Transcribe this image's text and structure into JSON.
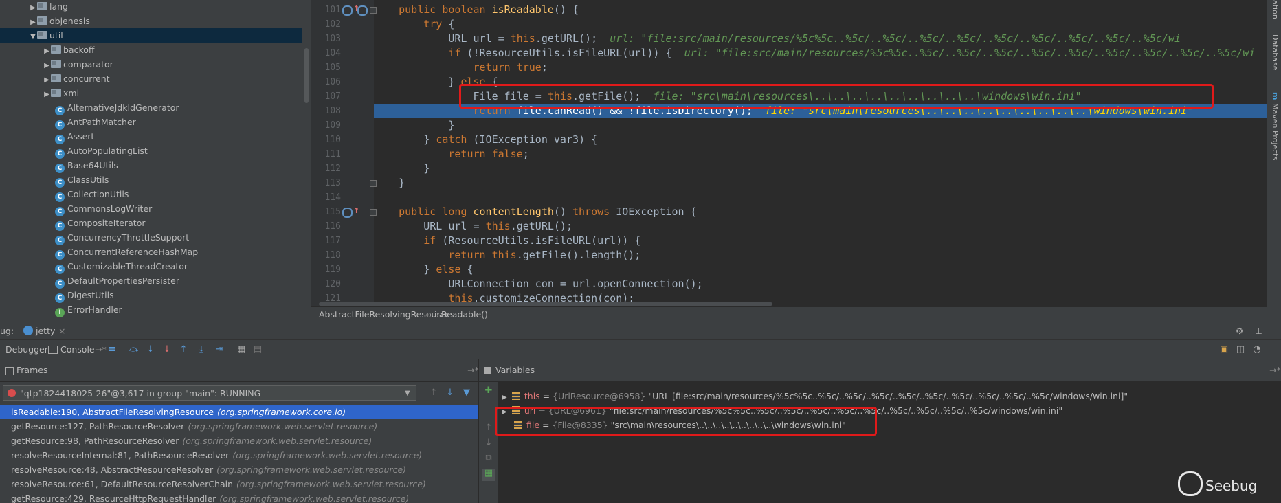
{
  "project_tree": [
    {
      "label": "lang",
      "kind": "folder",
      "depth": 2,
      "expanded": false,
      "selected": false
    },
    {
      "label": "objenesis",
      "kind": "folder",
      "depth": 2,
      "expanded": false,
      "selected": false
    },
    {
      "label": "util",
      "kind": "folder",
      "depth": 2,
      "expanded": true,
      "selected": true
    },
    {
      "label": "backoff",
      "kind": "folder",
      "depth": 3,
      "expanded": false,
      "selected": false
    },
    {
      "label": "comparator",
      "kind": "folder",
      "depth": 3,
      "expanded": false,
      "selected": false
    },
    {
      "label": "concurrent",
      "kind": "folder",
      "depth": 3,
      "expanded": false,
      "selected": false
    },
    {
      "label": "xml",
      "kind": "folder",
      "depth": 3,
      "expanded": false,
      "selected": false
    },
    {
      "label": "AlternativeJdkIdGenerator",
      "kind": "class",
      "depth": 3
    },
    {
      "label": "AntPathMatcher",
      "kind": "class",
      "depth": 3
    },
    {
      "label": "Assert",
      "kind": "class",
      "depth": 3
    },
    {
      "label": "AutoPopulatingList",
      "kind": "class",
      "depth": 3
    },
    {
      "label": "Base64Utils",
      "kind": "class",
      "depth": 3
    },
    {
      "label": "ClassUtils",
      "kind": "class",
      "depth": 3
    },
    {
      "label": "CollectionUtils",
      "kind": "class",
      "depth": 3
    },
    {
      "label": "CommonsLogWriter",
      "kind": "class",
      "depth": 3
    },
    {
      "label": "CompositeIterator",
      "kind": "class",
      "depth": 3
    },
    {
      "label": "ConcurrencyThrottleSupport",
      "kind": "class",
      "depth": 3
    },
    {
      "label": "ConcurrentReferenceHashMap",
      "kind": "class",
      "depth": 3
    },
    {
      "label": "CustomizableThreadCreator",
      "kind": "class",
      "depth": 3
    },
    {
      "label": "DefaultPropertiesPersister",
      "kind": "class",
      "depth": 3
    },
    {
      "label": "DigestUtils",
      "kind": "class",
      "depth": 3
    },
    {
      "label": "ErrorHandler",
      "kind": "interface",
      "depth": 3
    }
  ],
  "editor": {
    "lines": [
      {
        "n": "101",
        "segs": [
          [
            "kw",
            "    public boolean "
          ],
          [
            "fn",
            "isReadable"
          ],
          [
            "",
            "() {"
          ]
        ]
      },
      {
        "n": "102",
        "segs": [
          [
            "kw",
            "        try "
          ],
          [
            "",
            "{"
          ]
        ]
      },
      {
        "n": "103",
        "segs": [
          [
            "",
            "            URL url = "
          ],
          [
            "kw",
            "this"
          ],
          [
            "",
            ".getURL();  "
          ],
          [
            "hint",
            "url: \"file:src/main/resources/%5c%5c..%5c/..%5c/..%5c/..%5c/..%5c/..%5c/..%5c/..%5c/..%5c/wi"
          ]
        ]
      },
      {
        "n": "104",
        "segs": [
          [
            "kw",
            "            if "
          ],
          [
            "",
            "(!ResourceUtils."
          ],
          [
            "",
            "isFileURL(url)) {  "
          ],
          [
            "hint",
            "url: \"file:src/main/resources/%5c%5c..%5c/..%5c/..%5c/..%5c/..%5c/..%5c/..%5c/..%5c/..%5c/wi"
          ]
        ]
      },
      {
        "n": "105",
        "segs": [
          [
            "kw",
            "                return true"
          ],
          [
            "",
            ";"
          ]
        ]
      },
      {
        "n": "106",
        "segs": [
          [
            "",
            "            } "
          ],
          [
            "kw",
            "else "
          ],
          [
            "",
            "{"
          ]
        ]
      },
      {
        "n": "107",
        "segs": [
          [
            "",
            "                File file = "
          ],
          [
            "kw",
            "this"
          ],
          [
            "",
            ".getFile();  "
          ],
          [
            "hint",
            "file: \"src\\main\\resources\\..\\..\\..\\..\\..\\..\\..\\..\\..\\windows\\win.ini\""
          ]
        ]
      },
      {
        "n": "108",
        "exec": true,
        "segs": [
          [
            "kw",
            "                return "
          ],
          [
            "",
            "file.canRead() && !file.isDirectory();  "
          ],
          [
            "hint",
            "file: \"src\\main\\resources\\..\\..\\..\\..\\..\\..\\..\\..\\..\\windows\\win.ini\""
          ]
        ]
      },
      {
        "n": "109",
        "segs": [
          [
            "",
            "            }"
          ]
        ]
      },
      {
        "n": "110",
        "segs": [
          [
            "",
            "        } "
          ],
          [
            "kw",
            "catch "
          ],
          [
            "",
            "(IOException var3) {"
          ]
        ]
      },
      {
        "n": "111",
        "segs": [
          [
            "kw",
            "            return false"
          ],
          [
            "",
            ";"
          ]
        ]
      },
      {
        "n": "112",
        "segs": [
          [
            "",
            "        }"
          ]
        ]
      },
      {
        "n": "113",
        "segs": [
          [
            "",
            "    }"
          ]
        ]
      },
      {
        "n": "114",
        "segs": [
          [
            "",
            ""
          ]
        ]
      },
      {
        "n": "115",
        "segs": [
          [
            "kw",
            "    public long "
          ],
          [
            "fn",
            "contentLength"
          ],
          [
            "",
            "() "
          ],
          [
            "kw",
            "throws "
          ],
          [
            "",
            "IOException {"
          ]
        ]
      },
      {
        "n": "116",
        "segs": [
          [
            "",
            "        URL url = "
          ],
          [
            "kw",
            "this"
          ],
          [
            "",
            ".getURL();"
          ]
        ]
      },
      {
        "n": "117",
        "segs": [
          [
            "kw",
            "        if "
          ],
          [
            "",
            "(ResourceUtils."
          ],
          [
            "",
            "isFileURL(url)) {"
          ]
        ]
      },
      {
        "n": "118",
        "segs": [
          [
            "kw",
            "            return this"
          ],
          [
            "",
            ".getFile().length();"
          ]
        ]
      },
      {
        "n": "119",
        "segs": [
          [
            "",
            "        } "
          ],
          [
            "kw",
            "else "
          ],
          [
            "",
            "{"
          ]
        ]
      },
      {
        "n": "120",
        "segs": [
          [
            "",
            "            URLConnection con = url.openConnection();"
          ]
        ]
      },
      {
        "n": "121",
        "segs": [
          [
            "kw",
            "            this"
          ],
          [
            "",
            ".customizeConnection(con);"
          ]
        ]
      }
    ]
  },
  "breadcrumb": {
    "class": "AbstractFileResolvingResource",
    "sep": "›",
    "method": "isReadable()"
  },
  "right_strip": {
    "database": "Database",
    "maven": "Maven Projects",
    "top": "ation"
  },
  "debug": {
    "label": "ug:",
    "session_tab": "jetty",
    "tabs": {
      "debugger": "Debugger",
      "console": "Console",
      "console_suffix": "→*"
    },
    "frames_title": "Frames",
    "frames_pin": "→*",
    "variables_title": "Variables",
    "variables_pin": "→*",
    "thread": "\"qtp1824418025-26\"@3,617 in group \"main\": RUNNING",
    "frames": [
      {
        "method": "isReadable:190, AbstractFileResolvingResource",
        "pkg": "(org.springframework.core.io)",
        "selected": true
      },
      {
        "method": "getResource:127, PathResourceResolver",
        "pkg": "(org.springframework.web.servlet.resource)",
        "selected": false
      },
      {
        "method": "getResource:98, PathResourceResolver",
        "pkg": "(org.springframework.web.servlet.resource)",
        "selected": false
      },
      {
        "method": "resolveResourceInternal:81, PathResourceResolver",
        "pkg": "(org.springframework.web.servlet.resource)",
        "selected": false
      },
      {
        "method": "resolveResource:48, AbstractResourceResolver",
        "pkg": "(org.springframework.web.servlet.resource)",
        "selected": false
      },
      {
        "method": "resolveResource:61, DefaultResourceResolverChain",
        "pkg": "(org.springframework.web.servlet.resource)",
        "selected": false
      },
      {
        "method": "getResource:429, ResourceHttpRequestHandler",
        "pkg": "(org.springframework.web.servlet.resource)",
        "selected": false
      }
    ],
    "variables": [
      {
        "name": "this",
        "type": "{UrlResource@6958}",
        "value": "\"URL [file:src/main/resources/%5c%5c..%5c/..%5c/..%5c/..%5c/..%5c/..%5c/..%5c/..%5c/..%5c/windows/win.ini]\"",
        "expandable": true
      },
      {
        "name": "url",
        "type": "{URL@6961}",
        "value": "\"file:src/main/resources/%5c%5c..%5c/..%5c/..%5c/..%5c/..%5c/..%5c/..%5c/..%5c/..%5c/windows/win.ini\"",
        "expandable": true
      },
      {
        "name": "file",
        "type": "{File@8335}",
        "value": "\"src\\main\\resources\\..\\..\\..\\..\\..\\..\\..\\..\\..\\windows\\win.ini\"",
        "expandable": false
      }
    ]
  },
  "watermark": "Seebug",
  "colors": {
    "highlight_box": "#e01a1a",
    "exec_line": "#2d6099",
    "selected_frame": "#2f65ca",
    "keyword": "#cc7832",
    "method": "#ffc66d",
    "hint": "#629755"
  }
}
